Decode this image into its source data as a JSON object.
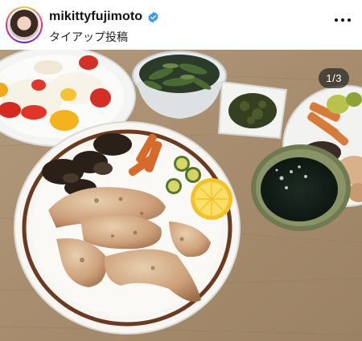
{
  "post": {
    "username": "mikittyfujimoto",
    "subtitle": "タイアップ投稿",
    "verified": true,
    "image_counter": "1/3"
  },
  "icons": {
    "verified": "verified-badge-icon",
    "more": "more-options-icon"
  },
  "colors": {
    "verified_blue": "#3897f0",
    "table_wood": "#a88c6c",
    "plate_rim_brown": "#6b3a1f"
  }
}
